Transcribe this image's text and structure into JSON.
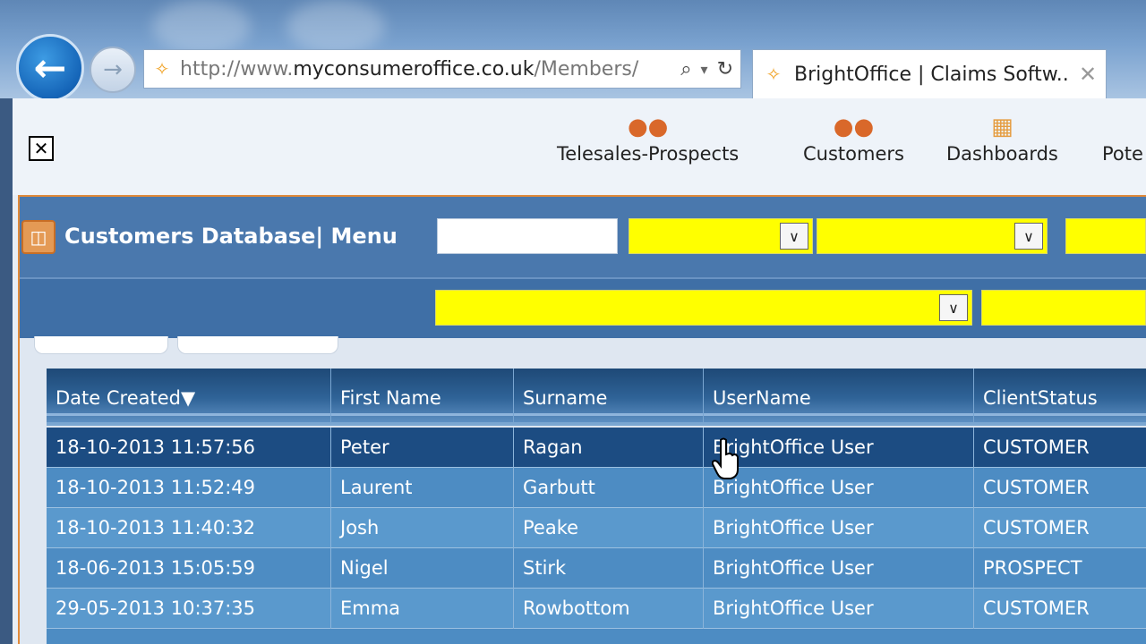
{
  "browser": {
    "url_prefix": "http://www.",
    "url_domain": "myconsumeroffice.co.uk",
    "url_path": "/Members/",
    "tab_title": "BrightOffice | Claims Softw...",
    "back_icon": "←",
    "forward_icon": "→",
    "search_icon": "⌕",
    "dropdown_icon": "▾",
    "refresh_icon": "↻",
    "tab_close_icon": "✕",
    "site_icon": "✧"
  },
  "topnav": {
    "close_icon": "✕",
    "items": [
      {
        "label": "Telesales-Prospects",
        "icon": "people-icon"
      },
      {
        "label": "Customers",
        "icon": "people-icon"
      },
      {
        "label": "Dashboards",
        "icon": "dashboard-icon"
      },
      {
        "label": "Pote",
        "icon": "people-icon"
      }
    ]
  },
  "module": {
    "title": "Customers Database| Menu",
    "search_value": "",
    "dropdown_arrow": "∨"
  },
  "table": {
    "columns": [
      "Date Created▼",
      "First Name",
      "Surname",
      "UserName",
      "ClientStatus"
    ],
    "rows": [
      [
        "18-10-2013 11:57:56",
        "Peter",
        "Ragan",
        "BrightOffice User",
        "CUSTOMER"
      ],
      [
        "18-10-2013 11:52:49",
        "Laurent",
        "Garbutt",
        "BrightOffice User",
        "CUSTOMER"
      ],
      [
        "18-10-2013 11:40:32",
        "Josh",
        "Peake",
        "BrightOffice User",
        "CUSTOMER"
      ],
      [
        "18-06-2013 15:05:59",
        "Nigel",
        "Stirk",
        "BrightOffice User",
        "PROSPECT"
      ],
      [
        "29-05-2013 10:37:35",
        "Emma",
        "Rowbottom",
        "BrightOffice User",
        "CUSTOMER"
      ]
    ],
    "selected_row": 0
  },
  "colors": {
    "accent_orange": "#e08a3a",
    "header_blue": "#4a78ad",
    "select_yellow": "#ffff00",
    "selected_row": "#1c4c82"
  }
}
